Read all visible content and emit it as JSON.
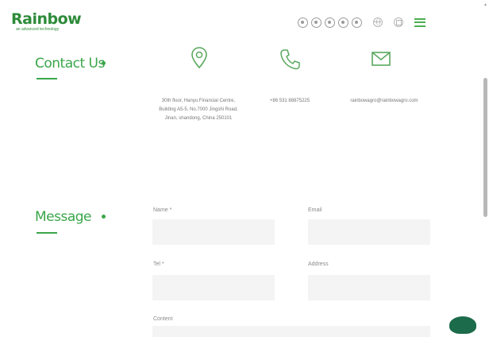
{
  "brand": {
    "name": "Rainbow",
    "tagline": "an advanced technology",
    "color": "#2e8b3a"
  },
  "header": {
    "social_icons": [
      "social-icon-1",
      "social-icon-2",
      "social-icon-3",
      "social-icon-4",
      "social-icon-5"
    ],
    "utility_icons": [
      "globe-icon",
      "language-icon",
      "menu-icon"
    ]
  },
  "contact": {
    "title": "Contact Us",
    "address": "30th floor, Hanyu Financial Centre, Building A5-5, No.7000 Jingshi Road, Jinan, shandong, China 250101",
    "phone": "+86 531 88875225",
    "email": "rainbowagro@rainbowagro.com",
    "icons": [
      "location-pin-icon",
      "phone-icon",
      "mail-icon"
    ]
  },
  "message": {
    "title": "Message",
    "fields": {
      "name": {
        "label": "Name *",
        "value": ""
      },
      "email": {
        "label": "Email",
        "value": ""
      },
      "tel": {
        "label": "Tel *",
        "value": ""
      },
      "address": {
        "label": "Address",
        "value": ""
      },
      "content": {
        "label": "Content",
        "value": ""
      }
    }
  },
  "colors": {
    "accent": "#3aa64a",
    "field_bg": "#f3f4f3",
    "chat": "#1c6b4b"
  }
}
